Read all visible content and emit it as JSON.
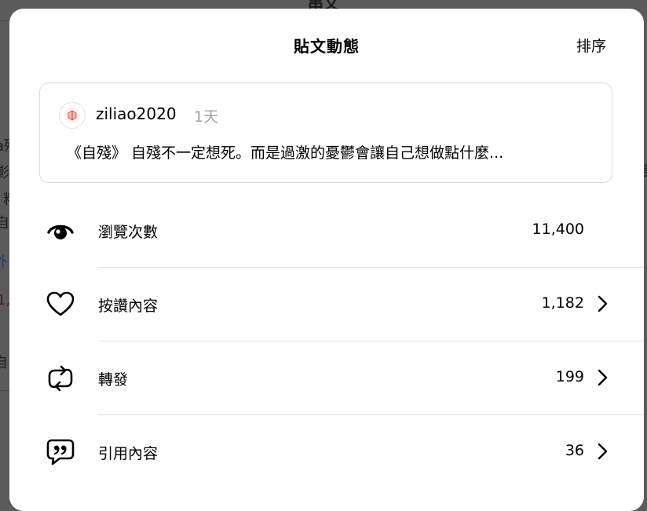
{
  "background": {
    "title": "串文",
    "fragments": [
      "a殘",
      "影不",
      "料",
      "自",
      "外",
      "1,",
      "自",
      "美"
    ]
  },
  "modal": {
    "title": "貼文動態",
    "sort_label": "排序",
    "post": {
      "username": "ziliao2020",
      "timestamp": "1天",
      "text": "《自殘》 自殘不一定想死。而是過激的憂鬱會讓自己想做點什麼..."
    },
    "stats": [
      {
        "label": "瀏覽次數",
        "value": "11,400",
        "icon": "eye-icon",
        "has_chevron": false
      },
      {
        "label": "按讚內容",
        "value": "1,182",
        "icon": "heart-icon",
        "has_chevron": true
      },
      {
        "label": "轉發",
        "value": "199",
        "icon": "repost-icon",
        "has_chevron": true
      },
      {
        "label": "引用內容",
        "value": "36",
        "icon": "quote-icon",
        "has_chevron": true
      }
    ]
  },
  "colors": {
    "overlay": "#5b5b5b",
    "modal_bg": "#ffffff",
    "muted_text": "#a0a0a0",
    "divider": "#e0e0e0"
  }
}
